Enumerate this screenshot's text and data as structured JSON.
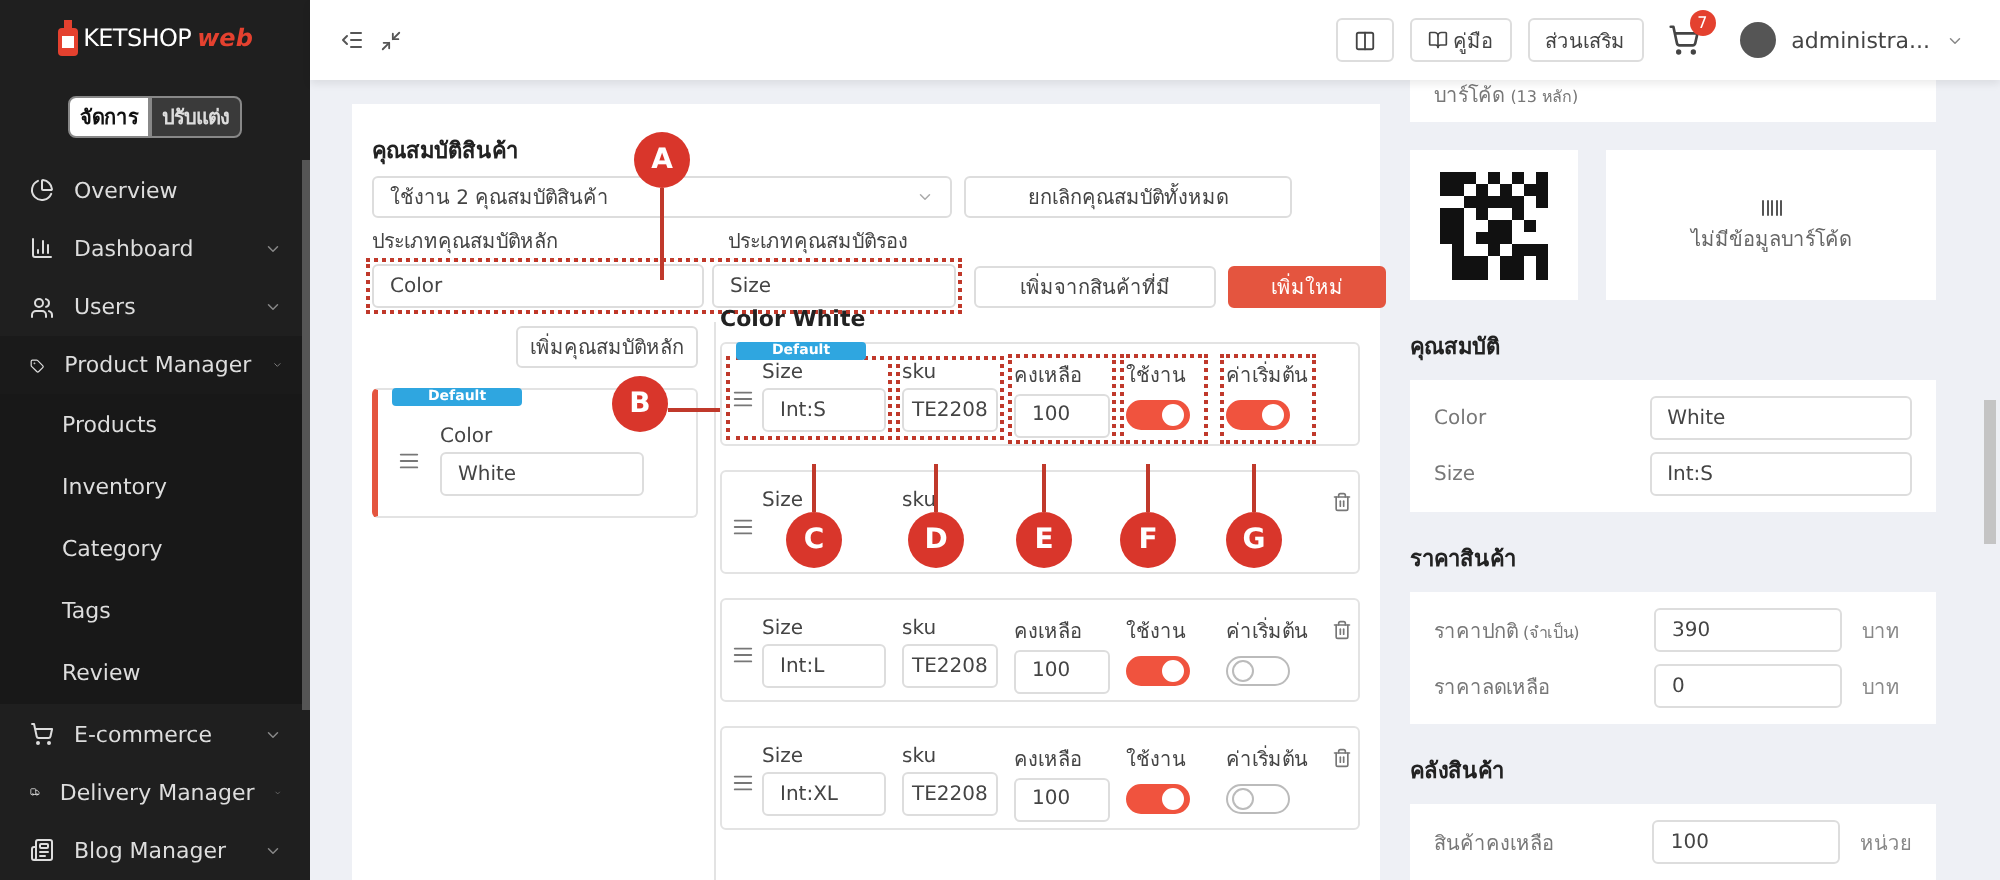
{
  "brand": {
    "name": "KETSHOP",
    "suffix": "web"
  },
  "mode_tabs": [
    {
      "label": "จัดการ",
      "selected": true
    },
    {
      "label": "ปรับแต่ง",
      "selected": false
    }
  ],
  "sidebar": {
    "items": [
      {
        "label": "Overview"
      },
      {
        "label": "Dashboard",
        "expanded": false
      },
      {
        "label": "Users",
        "expanded": false
      },
      {
        "label": "Product Manager",
        "expanded": true,
        "children": [
          {
            "label": "Products"
          },
          {
            "label": "Inventory"
          },
          {
            "label": "Category"
          },
          {
            "label": "Tags"
          },
          {
            "label": "Review"
          }
        ]
      },
      {
        "label": "E-commerce",
        "expanded": false
      },
      {
        "label": "Delivery Manager",
        "expanded": false
      },
      {
        "label": "Blog Manager",
        "expanded": false
      }
    ]
  },
  "topbar": {
    "guide": "คู่มือ",
    "addons": "ส่วนเสริม",
    "cart_count": "7",
    "user": "administra..."
  },
  "attributes": {
    "title": "คุณสมบัติสินค้า",
    "select_value": "ใช้งาน 2 คุณสมบัติสินค้า",
    "cancel_all": "ยกเลิกคุณสมบัติทั้งหมด",
    "main_label": "ประเภทคุณสมบัติหลัก",
    "main_value": "Color",
    "sub_label": "ประเภทคุณสมบัติรอง",
    "sub_value": "Size",
    "add_existing": "เพิ่มจากสินค้าที่มี",
    "add_new": "เพิ่มใหม่",
    "add_main": "เพิ่มคุณสมบัติหลัก",
    "main_items": [
      {
        "badge": "Default",
        "label": "Color",
        "value": "White",
        "selected": true
      }
    ],
    "group_title": "Color White",
    "variants": [
      {
        "badge": "Default",
        "size_label": "Size",
        "size": "Int:S",
        "sku_label": "sku",
        "sku": "TE2208",
        "stock_label": "คงเหลือ",
        "stock": "100",
        "active_label": "ใช้งาน",
        "active": true,
        "default_label": "ค่าเริ่มต้น",
        "default": true,
        "deletable": false
      },
      {
        "size_label": "Size",
        "sku_label": "sku",
        "deletable": true
      },
      {
        "size_label": "Size",
        "size": "Int:L",
        "sku_label": "sku",
        "sku": "TE2208",
        "stock_label": "คงเหลือ",
        "stock": "100",
        "active_label": "ใช้งาน",
        "active": true,
        "default_label": "ค่าเริ่มต้น",
        "default": false,
        "deletable": true
      },
      {
        "size_label": "Size",
        "size": "Int:XL",
        "sku_label": "sku",
        "sku": "TE2208",
        "stock_label": "คงเหลือ",
        "stock": "100",
        "active_label": "ใช้งาน",
        "active": true,
        "default_label": "ค่าเริ่มต้น",
        "default": false,
        "deletable": true
      }
    ]
  },
  "side_panel": {
    "barcode_label": "บาร์โค้ด",
    "barcode_hint": "(13 หลัก)",
    "no_barcode": "ไม่มีข้อมูลบาร์โค้ด",
    "props_title": "คุณสมบัติ",
    "props": [
      {
        "label": "Color",
        "value": "White"
      },
      {
        "label": "Size",
        "value": "Int:S"
      }
    ],
    "price_title": "ราคาสินค้า",
    "prices": [
      {
        "label": "ราคาปกติ",
        "hint": "(จำเป็น)",
        "value": "390",
        "unit": "บาท"
      },
      {
        "label": "ราคาลดเหลือ",
        "value": "0",
        "unit": "บาท"
      }
    ],
    "stock_title": "คลังสินค้า",
    "stock": [
      {
        "label": "สินค้าคงเหลือ",
        "value": "100",
        "unit": "หน่วย"
      }
    ]
  },
  "callouts": [
    {
      "label": "A"
    },
    {
      "label": "B"
    },
    {
      "label": "C"
    },
    {
      "label": "D"
    },
    {
      "label": "E"
    },
    {
      "label": "F"
    },
    {
      "label": "G"
    }
  ]
}
